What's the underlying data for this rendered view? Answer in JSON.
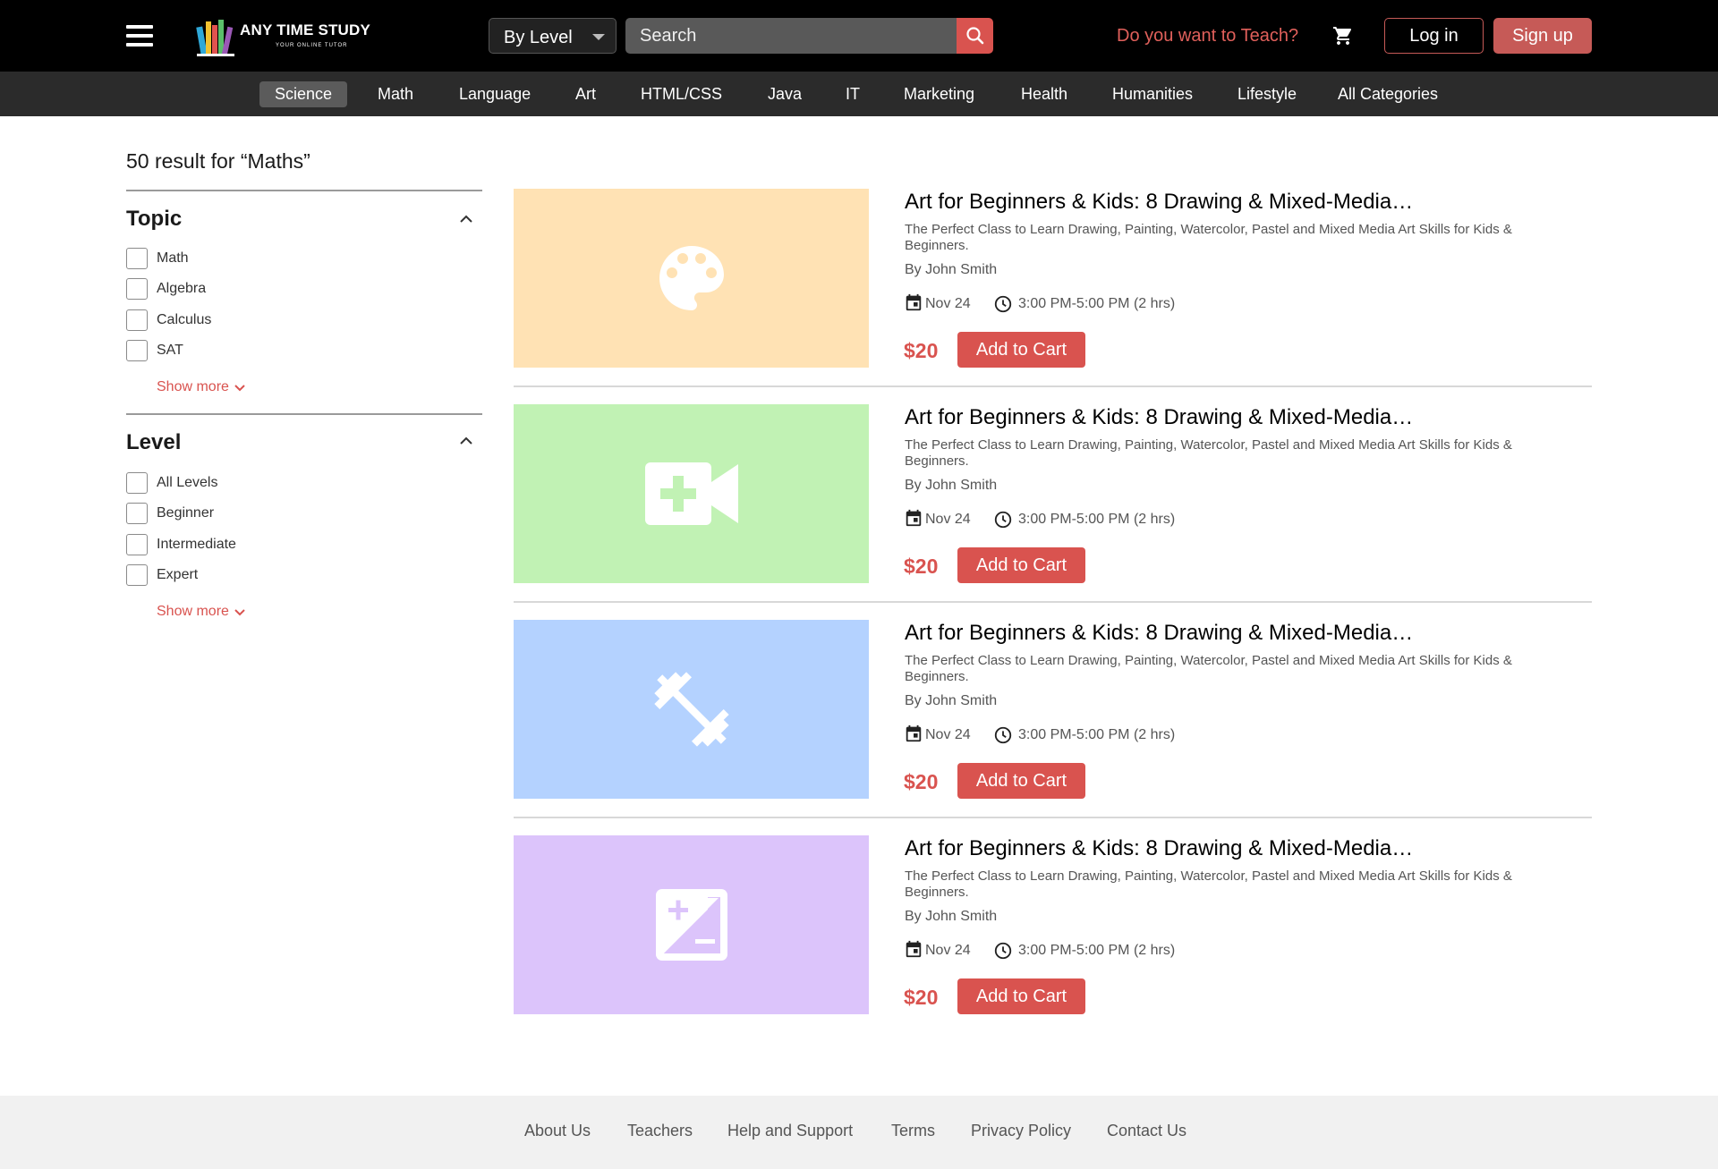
{
  "header": {
    "logo_text": "ANY TIME STUDY",
    "logo_tagline": "YOUR ONLINE TUTOR",
    "level_select": "By Level",
    "search_placeholder": "Search",
    "teach_link": "Do you want to Teach?",
    "login": "Log in",
    "signup": "Sign up"
  },
  "categories": [
    {
      "label": "Science",
      "active": true
    },
    {
      "label": "Math"
    },
    {
      "label": "Language"
    },
    {
      "label": "Art"
    },
    {
      "label": "HTML/CSS"
    },
    {
      "label": "Java"
    },
    {
      "label": "IT"
    },
    {
      "label": "Marketing"
    },
    {
      "label": "Health"
    },
    {
      "label": "Humanities"
    },
    {
      "label": "Lifestyle"
    },
    {
      "label": "All Categories"
    }
  ],
  "results": {
    "heading": "50 result for “Maths”"
  },
  "filters": {
    "topic": {
      "title": "Topic",
      "options": [
        "Math",
        "Algebra",
        "Calculus",
        "SAT"
      ],
      "show_more": "Show more"
    },
    "level": {
      "title": "Level",
      "options": [
        "All Levels",
        "Beginner",
        "Intermediate",
        "Expert"
      ],
      "show_more": "Show more"
    }
  },
  "courses": [
    {
      "title": "Art for Beginners & Kids: 8 Drawing & Mixed-Media…",
      "description": "The Perfect Class to Learn Drawing, Painting, Watercolor, Pastel and Mixed Media Art Skills for Kids & Beginners.",
      "author": "By John Smith",
      "date": "Nov 24",
      "time": "3:00 PM-5:00 PM (2 hrs)",
      "price": "$20",
      "cta": "Add to Cart",
      "thumb_color": "#ffe2b4",
      "icon": "palette-icon"
    },
    {
      "title": "Art for Beginners & Kids: 8 Drawing & Mixed-Media…",
      "description": "The Perfect Class to Learn Drawing, Painting, Watercolor, Pastel and Mixed Media Art Skills for Kids & Beginners.",
      "author": "By John Smith",
      "date": "Nov 24",
      "time": "3:00 PM-5:00 PM (2 hrs)",
      "price": "$20",
      "cta": "Add to Cart",
      "thumb_color": "#c1f2b4",
      "icon": "video-call-icon"
    },
    {
      "title": "Art for Beginners & Kids: 8 Drawing & Mixed-Media…",
      "description": "The Perfect Class to Learn Drawing, Painting, Watercolor, Pastel and Mixed Media Art Skills for Kids & Beginners.",
      "author": "By John Smith",
      "date": "Nov 24",
      "time": "3:00 PM-5:00 PM (2 hrs)",
      "price": "$20",
      "cta": "Add to Cart",
      "thumb_color": "#b4d2ff",
      "icon": "fitness-icon"
    },
    {
      "title": "Art for Beginners & Kids: 8 Drawing & Mixed-Media…",
      "description": "The Perfect Class to Learn Drawing, Painting, Watercolor, Pastel and Mixed Media Art Skills for Kids & Beginners.",
      "author": "By John Smith",
      "date": "Nov 24",
      "time": "3:00 PM-5:00 PM (2 hrs)",
      "price": "$20",
      "cta": "Add to Cart",
      "thumb_color": "#dcc4fb",
      "icon": "exposure-icon"
    }
  ],
  "footer": {
    "links": [
      "About Us",
      "Teachers",
      "Help and Support",
      "Terms",
      "Privacy Policy",
      "Contact Us"
    ]
  },
  "colors": {
    "accent": "#d9534f",
    "header_bg": "#000000",
    "nav_bg": "#2b2b2b",
    "footer_bg": "#f1f1f1"
  }
}
